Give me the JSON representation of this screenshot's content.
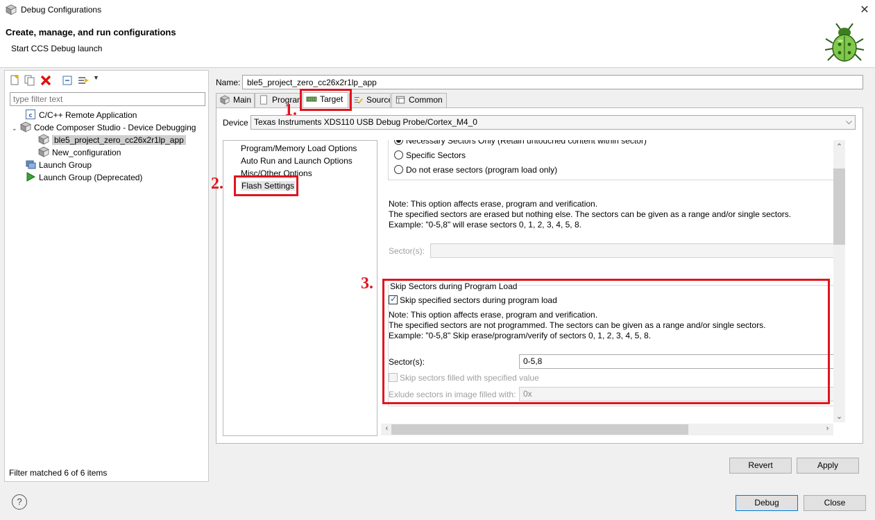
{
  "window": {
    "title": "Debug Configurations",
    "close_glyph": "✕"
  },
  "header": {
    "title": "Create, manage, and run configurations",
    "subtitle": "Start CCS Debug launch"
  },
  "left_panel": {
    "filter_placeholder": "type filter text",
    "tree": [
      {
        "label": "C/C++ Remote Application",
        "icon": "c-app-icon"
      },
      {
        "label": "Code Composer Studio - Device Debugging",
        "icon": "ccs-cube-icon",
        "expanded": true
      },
      {
        "label": "ble5_project_zero_cc26x2r1lp_app",
        "icon": "ccs-cube-icon",
        "selected": true
      },
      {
        "label": "New_configuration",
        "icon": "ccs-cube-icon"
      },
      {
        "label": "Launch Group",
        "icon": "launch-group-icon"
      },
      {
        "label": "Launch Group (Deprecated)",
        "icon": "run-arrow-icon"
      }
    ],
    "status": "Filter matched 6 of 6 items"
  },
  "name": {
    "label": "Name:",
    "value": "ble5_project_zero_cc26x2r1lp_app"
  },
  "tabs": [
    {
      "label": "Main"
    },
    {
      "label": "Program"
    },
    {
      "label": "Target",
      "active": true
    },
    {
      "label": "Source"
    },
    {
      "label": "Common"
    }
  ],
  "device": {
    "label": "Device",
    "value": "Texas Instruments XDS110 USB Debug Probe/Cortex_M4_0"
  },
  "categories": [
    "Program/Memory Load Options",
    "Auto Run and Launch Options",
    "Misc/Other Options",
    "Flash Settings"
  ],
  "erase": {
    "option_partial": "Necessary Sectors Only (Retain untouched content within sector)",
    "option_specific": "Specific Sectors",
    "option_none": "Do not erase sectors (program load only)",
    "note1": "Note: This option affects erase, program and verification.",
    "note2": "The specified sectors are erased but nothing else. The sectors can be given as a range and/or single sectors.",
    "note3": "Example: \"0-5,8\" will erase sectors 0, 1, 2, 3, 4, 5, 8.",
    "sectors_label": "Sector(s):",
    "sectors_value": ""
  },
  "skip": {
    "group_title": "Skip Sectors during Program Load",
    "checkbox_label": "Skip specified sectors during program load",
    "note1": "Note: This option affects erase, program and verification.",
    "note2": "The specified sectors are not programmed. The sectors can be given as a range and/or single sectors.",
    "note3": "Example: \"0-5,8\" Skip erase/program/verify of sectors 0, 1, 2, 3, 4, 5, 8.",
    "sectors_label": "Sector(s):",
    "sectors_value": "0-5,8",
    "filled_label": "Skip sectors filled with specified value",
    "exclude_label": "Exlude sectors in image filled with:",
    "exclude_value": "0x"
  },
  "annotations": {
    "a1": "1.",
    "a2": "2.",
    "a3": "3."
  },
  "buttons": {
    "revert": "Revert",
    "apply": "Apply",
    "debug": "Debug",
    "close": "Close",
    "help": "?"
  },
  "colors": {
    "annotation_red": "#e0141e",
    "focus_blue": "#0078d7"
  }
}
